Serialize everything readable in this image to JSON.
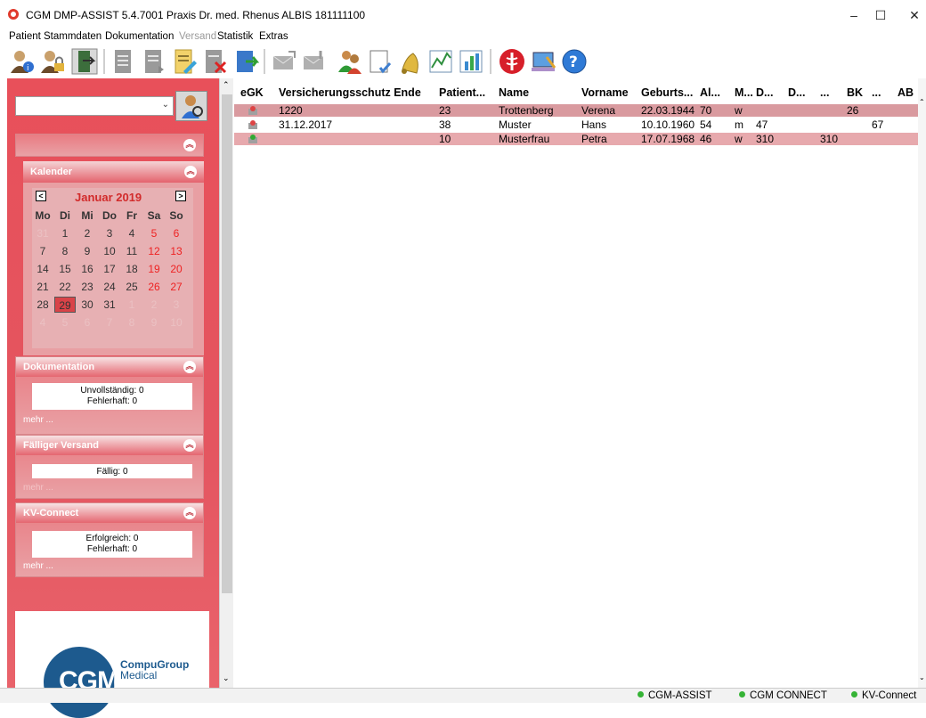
{
  "window": {
    "title": "CGM DMP-ASSIST 5.4.7001 Praxis Dr. med. Rhenus ALBIS 181111100",
    "minimize": "–",
    "maximize": "☐",
    "close": "✕"
  },
  "menu": [
    "Patient",
    "Stammdaten",
    "Dokumentation",
    "Versand",
    "Statistik",
    "Extras"
  ],
  "toolbar_icons": [
    "patient-info-icon",
    "patient-lock-icon",
    "door-exit-icon",
    "doc-gray-icon",
    "doc-gray2-icon",
    "doc-edit-icon",
    "doc-delete-icon",
    "export-icon",
    "envelope-gray-icon",
    "envelope-gray2-icon",
    "users-icon",
    "checklist-icon",
    "bell-icon",
    "chart-icon",
    "bar-chart-icon",
    "medical-icon",
    "monitor-icon",
    "help-icon"
  ],
  "sidebar": {
    "panel_open_collapse": "︽",
    "calendar": {
      "title": "Kalender",
      "month": "Januar 2019",
      "prev": "<",
      "next": ">",
      "days_of_week": [
        "Mo",
        "Di",
        "Mi",
        "Do",
        "Fr",
        "Sa",
        "So"
      ],
      "weeks": [
        [
          "31",
          "1",
          "2",
          "3",
          "4",
          "5",
          "6"
        ],
        [
          "7",
          "8",
          "9",
          "10",
          "11",
          "12",
          "13"
        ],
        [
          "14",
          "15",
          "16",
          "17",
          "18",
          "19",
          "20"
        ],
        [
          "21",
          "22",
          "23",
          "24",
          "25",
          "26",
          "27"
        ],
        [
          "28",
          "29",
          "30",
          "31",
          "1",
          "2",
          "3"
        ],
        [
          "4",
          "5",
          "6",
          "7",
          "8",
          "9",
          "10"
        ]
      ],
      "selected": "29"
    },
    "dokumentation": {
      "title": "Dokumentation",
      "lines": [
        "Unvollständig: 0",
        "Fehlerhaft: 0"
      ],
      "more": "mehr ..."
    },
    "versand": {
      "title": "Fälliger Versand",
      "lines": [
        "Fällig: 0"
      ],
      "more": "mehr ..."
    },
    "kvconnect": {
      "title": "KV-Connect",
      "lines": [
        "Erfolgreich: 0",
        "Fehlerhaft: 0"
      ],
      "more": "mehr ..."
    },
    "logo": {
      "mark": "CGM",
      "brand1": "CompuGroup",
      "brand2": "Medical"
    }
  },
  "table": {
    "columns": [
      "eGK",
      "Versicherungsschutz Ende",
      "Patient...",
      "Name",
      "Vorname",
      "Geburts...",
      "Al...",
      "M...",
      "D...",
      "D...",
      "...",
      "BK",
      "...",
      "AB"
    ],
    "rows": [
      {
        "ende": "1220",
        "patient": "23",
        "name": "Trottenberg",
        "vorname": "Verena",
        "geburt": "22.03.1944",
        "alter": "70",
        "m": "w",
        "d1": "",
        "d2": "",
        "dots": "",
        "bk": "26",
        "dots2": "",
        "ab": ""
      },
      {
        "ende": "31.12.2017",
        "patient": "38",
        "name": "Muster",
        "vorname": "Hans",
        "geburt": "10.10.1960",
        "alter": "54",
        "m": "m",
        "d1": "47",
        "d2": "",
        "dots": "",
        "bk": "",
        "dots2": "67",
        "ab": ""
      },
      {
        "ende": "",
        "patient": "10",
        "name": "Musterfrau",
        "vorname": "Petra",
        "geburt": "17.07.1968",
        "alter": "46",
        "m": "w",
        "d1": "310",
        "d2": "",
        "dots": "310",
        "bk": "",
        "dots2": "",
        "ab": ""
      }
    ]
  },
  "status": [
    "CGM-ASSIST",
    "CGM CONNECT",
    "KV-Connect"
  ],
  "colors": {
    "sidebar": "#e45560",
    "row_highlight": "#d99a9f",
    "row_white": "#ffffff",
    "status_ok": "#35b335"
  }
}
